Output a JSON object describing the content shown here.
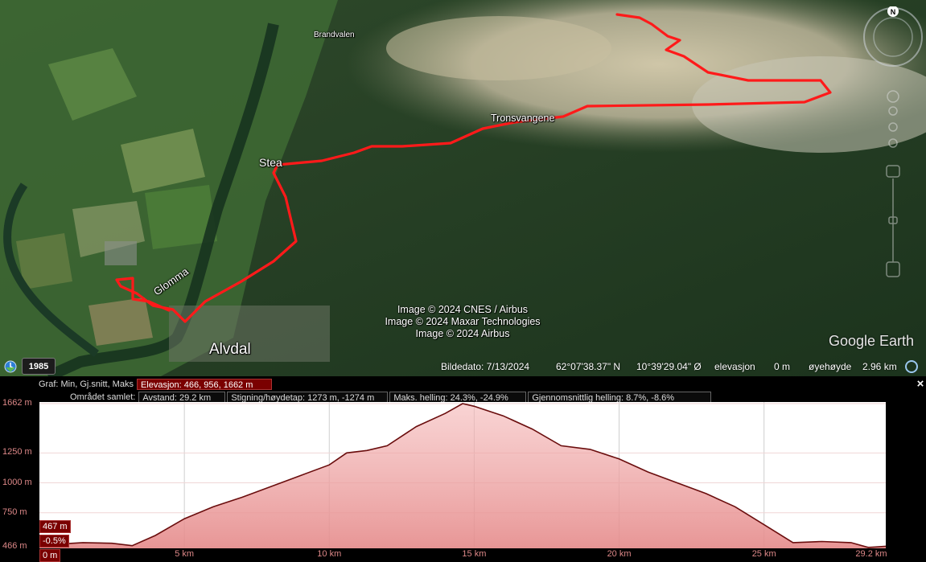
{
  "map": {
    "labels": {
      "brandvalen": "Brandvalen",
      "stea": "Stea",
      "tronsvangene": "Tronsvangene",
      "glomma": "Glomma",
      "alvdal": "Alvdal"
    },
    "credits": [
      "Image © 2024 CNES / Airbus",
      "Image © 2024 Maxar Technologies",
      "Image © 2024 Airbus"
    ],
    "brand": "Google Earth",
    "compass_letter": "N",
    "route_color": "#ff1a1a"
  },
  "status_bar": {
    "year_badge": "1985",
    "image_date": "Bildedato: 7/13/2024",
    "latitude": "62°07'38.37\" N",
    "longitude": "10°39'29.04\" Ø",
    "elevation_label": "elevasjon",
    "elevation_value": "0 m",
    "eye_label": "øyehøyde",
    "eye_value": "2.96 km"
  },
  "profile": {
    "row1": {
      "label": "Graf: Min, Gj.snitt, Maks",
      "elevation": "Elevasjon: 466, 956, 1662 m"
    },
    "row2": {
      "label": "Området samlet:",
      "distance": "Avstand: 29.2 km",
      "climb": "Stigning/høydetap: 1273 m, -1274 m",
      "max_slope": "Maks. helling: 24.3%, -24.9%",
      "avg_slope": "Gjennomsnittlig helling: 8.7%, -8.6%"
    },
    "close_icon": "×",
    "cursor_elevation": "467 m",
    "cursor_slope": "-0.5%",
    "cursor_distance": "0 m"
  },
  "chart_data": {
    "type": "area",
    "xlabel": "",
    "ylabel": "",
    "x_unit": "km",
    "y_unit": "m",
    "xlim": [
      0,
      29.2
    ],
    "ylim": [
      466,
      1662
    ],
    "x_ticks": [
      "0 m",
      "5 km",
      "10 km",
      "15 km",
      "20 km",
      "25 km",
      "29.2 km"
    ],
    "x_tick_values": [
      0,
      5,
      10,
      15,
      20,
      25,
      29.2
    ],
    "y_ticks": [
      "1662 m",
      "1250 m",
      "1000 m",
      "750 m",
      "466 m"
    ],
    "y_tick_values": [
      1662,
      1250,
      1000,
      750,
      466
    ],
    "grid": true,
    "fill_color": "#f4b6b6",
    "line_color": "#6a0d0d",
    "series": [
      {
        "x": [
          0,
          0.8,
          1.5,
          2.5,
          3.2,
          4.0,
          5.0,
          6.0,
          7.0,
          8.0,
          9.0,
          10.0,
          10.6,
          11.3,
          12.0,
          13.0,
          14.0,
          14.6,
          15.0,
          16.0,
          17.0,
          18.0,
          19.0,
          20.0,
          21.0,
          22.0,
          23.0,
          24.0,
          25.0,
          26.0,
          27.0,
          28.0,
          28.6,
          29.2
        ],
        "y": [
          467,
          490,
          500,
          495,
          475,
          560,
          700,
          800,
          880,
          970,
          1060,
          1150,
          1250,
          1270,
          1310,
          1470,
          1580,
          1662,
          1640,
          1560,
          1450,
          1310,
          1280,
          1200,
          1090,
          1000,
          910,
          800,
          650,
          500,
          510,
          500,
          460,
          470
        ]
      }
    ]
  }
}
